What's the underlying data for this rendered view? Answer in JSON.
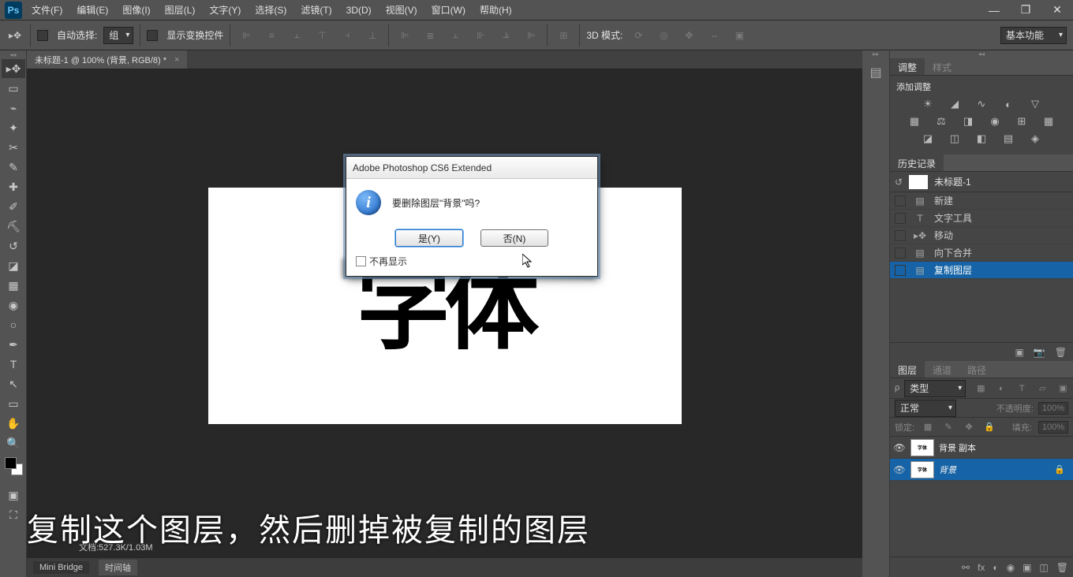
{
  "app": {
    "logo": "Ps"
  },
  "menu": [
    "文件(F)",
    "编辑(E)",
    "图像(I)",
    "图层(L)",
    "文字(Y)",
    "选择(S)",
    "滤镜(T)",
    "3D(D)",
    "视图(V)",
    "窗口(W)",
    "帮助(H)"
  ],
  "options": {
    "auto_select": "自动选择:",
    "group": "组",
    "show_transform": "显示变换控件",
    "mode3d": "3D 模式:",
    "workspace": "基本功能"
  },
  "doctab": {
    "title": "未标题-1 @ 100% (背景, RGB/8) *"
  },
  "canvas": {
    "text": "字体"
  },
  "subtitle": "复制这个图层，然后删掉被复制的图层",
  "dialog": {
    "title": "Adobe Photoshop CS6 Extended",
    "message": "要删除图层\"背景\"吗?",
    "yes": "是(Y)",
    "no": "否(N)",
    "noshow": "不再显示"
  },
  "panels": {
    "adjust_tab": "调整",
    "style_tab": "样式",
    "add_adjust": "添加调整",
    "history_tab": "历史记录",
    "history_doc": "未标题-1",
    "history_items": [
      {
        "icon": "▤",
        "label": "新建"
      },
      {
        "icon": "T",
        "label": "文字工具"
      },
      {
        "icon": "▸✥",
        "label": "移动"
      },
      {
        "icon": "▤",
        "label": "向下合并"
      },
      {
        "icon": "▤",
        "label": "复制图层"
      }
    ],
    "layers_tab": "图层",
    "channels_tab": "通道",
    "paths_tab": "路径",
    "kind": "类型",
    "blend": "正常",
    "opacity_label": "不透明度:",
    "opacity_val": "100%",
    "lock_label": "锁定:",
    "fill_label": "填充:",
    "fill_val": "100%",
    "layers": [
      {
        "name": "背景 副本",
        "thumb": "字体",
        "locked": false,
        "sel": false
      },
      {
        "name": "背景",
        "thumb": "字体",
        "locked": true,
        "sel": true
      }
    ]
  },
  "status": {
    "tabs": [
      "Mini Bridge",
      "时间轴"
    ],
    "info": "文档:527.3K/1.03M"
  }
}
